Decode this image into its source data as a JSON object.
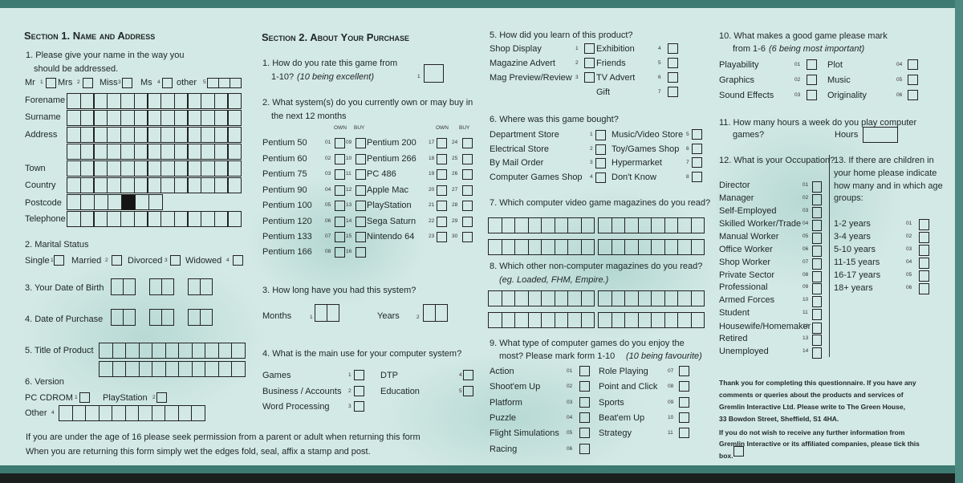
{
  "section1": {
    "heading": "Section 1. Name and Address",
    "q1": {
      "line1": "1. Please give your name in the way you",
      "line2": "should be addressed.",
      "titles": [
        {
          "label": "Mr",
          "code": "1"
        },
        {
          "label": "Mrs",
          "code": "2"
        },
        {
          "label": "Miss",
          "code": "3"
        },
        {
          "label": "Ms",
          "code": "4"
        },
        {
          "label": "other",
          "code": "5"
        }
      ],
      "fields": [
        "Forename",
        "Surname",
        "Address",
        "Town",
        "Country",
        "Postcode",
        "Telephone"
      ]
    },
    "q2": {
      "title": "2. Marital Status",
      "options": [
        {
          "label": "Single",
          "code": "1"
        },
        {
          "label": "Married",
          "code": "2"
        },
        {
          "label": "Divorced",
          "code": "3"
        },
        {
          "label": "Widowed",
          "code": "4"
        }
      ]
    },
    "q3": "3. Your Date of Birth",
    "q4": "4. Date of Purchase",
    "q5": "5. Title of Product",
    "q6": {
      "title": "6. Version",
      "options": [
        {
          "label": "PC CDROM",
          "code": "1"
        },
        {
          "label": "PlayStation",
          "code": "2"
        }
      ],
      "other": {
        "label": "Other",
        "code": "4"
      }
    },
    "footer": [
      "If you are under the age of 16 please seek permission from a parent or adult when returning this form",
      "When you are returning this form simply wet the edges fold, seal, affix a stamp and post."
    ]
  },
  "section2": {
    "heading": "Section 2. About Your Purchase",
    "q1": {
      "line1": "1. How do you rate this game from",
      "line2": "1-10?",
      "line2_note": "(10 being excellent)",
      "code": "1"
    },
    "q2": {
      "line1": "2. What system(s) do you currently own or may buy in",
      "line2": "the next 12 months",
      "own": "OWN",
      "buy": "BUY",
      "left": [
        {
          "label": "Pentium 50",
          "own": "01",
          "buy": "09"
        },
        {
          "label": "Pentium 60",
          "own": "02",
          "buy": "10"
        },
        {
          "label": "Pentium 75",
          "own": "03",
          "buy": "11"
        },
        {
          "label": "Pentium 90",
          "own": "04",
          "buy": "12"
        },
        {
          "label": "Pentium 100",
          "own": "05",
          "buy": "13"
        },
        {
          "label": "Pentium 120",
          "own": "06",
          "buy": "14"
        },
        {
          "label": "Pentium 133",
          "own": "07",
          "buy": "15"
        },
        {
          "label": "Pentium 166",
          "own": "08",
          "buy": "16"
        }
      ],
      "right": [
        {
          "label": "Pentium 200",
          "own": "17",
          "buy": "24"
        },
        {
          "label": "Pentium 266",
          "own": "18",
          "buy": "25"
        },
        {
          "label": "PC 486",
          "own": "19",
          "buy": "26"
        },
        {
          "label": "Apple Mac",
          "own": "20",
          "buy": "27"
        },
        {
          "label": "PlayStation",
          "own": "21",
          "buy": "28"
        },
        {
          "label": "Sega Saturn",
          "own": "22",
          "buy": "29"
        },
        {
          "label": "Nintendo 64",
          "own": "23",
          "buy": "30"
        }
      ]
    },
    "q3": {
      "title": "3. How long have you had this system?",
      "months": "Months",
      "months_code": "1",
      "years": "Years",
      "years_code": "2"
    },
    "q4": {
      "title": "4. What is the main use for your computer system?",
      "left": [
        {
          "label": "Games",
          "code": "1"
        },
        {
          "label": "Business / Accounts",
          "code": "2"
        },
        {
          "label": "Word Processing",
          "code": "3"
        }
      ],
      "right": [
        {
          "label": "DTP",
          "code": "4"
        },
        {
          "label": "Education",
          "code": "5"
        }
      ]
    }
  },
  "column3": {
    "q5": {
      "title": "5. How did you learn of this product?",
      "left": [
        {
          "label": "Shop Display",
          "code": "1"
        },
        {
          "label": "Magazine Advert",
          "code": "2"
        },
        {
          "label": "Mag Preview/Review",
          "code": "3"
        }
      ],
      "right": [
        {
          "label": "Exhibition",
          "code": "4"
        },
        {
          "label": "Friends",
          "code": "5"
        },
        {
          "label": "TV Advert",
          "code": "6"
        },
        {
          "label": "Gift",
          "code": "7"
        }
      ]
    },
    "q6": {
      "title": "6. Where was this game bought?",
      "left": [
        {
          "label": "Department Store",
          "code": "1"
        },
        {
          "label": "Electrical Store",
          "code": "2"
        },
        {
          "label": "By Mail Order",
          "code": "3"
        },
        {
          "label": "Computer Games Shop",
          "code": "4"
        }
      ],
      "right": [
        {
          "label": "Music/Video Store",
          "code": "5"
        },
        {
          "label": "Toy/Games Shop",
          "code": "6"
        },
        {
          "label": "Hypermarket",
          "code": "7"
        },
        {
          "label": "Don't Know",
          "code": "8"
        }
      ]
    },
    "q7": {
      "title": "7. Which computer video game magazines do you read?"
    },
    "q8": {
      "title": "8. Which other non-computer magazines do you read?",
      "note": "(eg. Loaded, FHM, Empire.)"
    },
    "q9": {
      "line1": "9. What type of computer games do you enjoy the",
      "line2": "most? Please mark form 1-10",
      "line2_note": "(10 being favourite)",
      "left": [
        {
          "label": "Action",
          "code": "01"
        },
        {
          "label": "Shoot'em Up",
          "code": "02"
        },
        {
          "label": "Platform",
          "code": "03"
        },
        {
          "label": "Puzzle",
          "code": "04"
        },
        {
          "label": "Flight Simulations",
          "code": "05"
        },
        {
          "label": "Racing",
          "code": "06"
        }
      ],
      "right": [
        {
          "label": "Role Playing",
          "code": "07"
        },
        {
          "label": "Point and Click",
          "code": "08"
        },
        {
          "label": "Sports",
          "code": "09"
        },
        {
          "label": "Beat'em Up",
          "code": "10"
        },
        {
          "label": "Strategy",
          "code": "11"
        }
      ]
    }
  },
  "column4": {
    "q10": {
      "line1": "10. What makes a good game please mark",
      "line2": "from 1-6",
      "line2_note": "(6 being most important)",
      "left": [
        {
          "label": "Playability",
          "code": "01"
        },
        {
          "label": "Graphics",
          "code": "02"
        },
        {
          "label": "Sound Effects",
          "code": "03"
        }
      ],
      "right": [
        {
          "label": "Plot",
          "code": "04"
        },
        {
          "label": "Music",
          "code": "05"
        },
        {
          "label": "Originality",
          "code": "06"
        }
      ]
    },
    "q11": {
      "line1": "11. How many hours a week do you play computer",
      "line2": "games?",
      "hours": "Hours"
    },
    "q12": {
      "title": "12. What is your Occupation?",
      "options": [
        {
          "label": "Director",
          "code": "01"
        },
        {
          "label": "Manager",
          "code": "02"
        },
        {
          "label": "Self-Employed",
          "code": "03"
        },
        {
          "label": "Skilled Worker/Trade",
          "code": "04"
        },
        {
          "label": "Manual Worker",
          "code": "05"
        },
        {
          "label": "Office Worker",
          "code": "06"
        },
        {
          "label": "Shop Worker",
          "code": "07"
        },
        {
          "label": "Private Sector",
          "code": "08"
        },
        {
          "label": "Professional",
          "code": "09"
        },
        {
          "label": "Armed Forces",
          "code": "10"
        },
        {
          "label": "Student",
          "code": "11"
        },
        {
          "label": "Housewife/Homemaker",
          "code": "12"
        },
        {
          "label": "Retired",
          "code": "13"
        },
        {
          "label": "Unemployed",
          "code": "14"
        }
      ]
    },
    "q13": {
      "lines": [
        "13. If there are children in",
        "your home please indicate",
        "how many and in which age",
        "groups:"
      ],
      "options": [
        {
          "label": "1-2 years",
          "code": "01"
        },
        {
          "label": "3-4 years",
          "code": "02"
        },
        {
          "label": "5-10 years",
          "code": "03"
        },
        {
          "label": "11-15 years",
          "code": "04"
        },
        {
          "label": "16-17 years",
          "code": "05"
        },
        {
          "label": "18+ years",
          "code": "06"
        }
      ]
    },
    "thanks": [
      "Thank you for completing this questionnaire. If you have any",
      "comments or queries about the products and services of",
      "Gremlin Interactive Ltd. Please write to The Green House,",
      "33 Bowdon Street, Sheffield, S1 4HA."
    ],
    "optout": [
      "If you do not wish to receive any further information from",
      "Gremlin Interactive or its affiliated companies, please tick this",
      "box."
    ]
  },
  "colors": {
    "paper": "#d3e9e5",
    "band": "#3d7a72",
    "ink": "#1e2624"
  }
}
